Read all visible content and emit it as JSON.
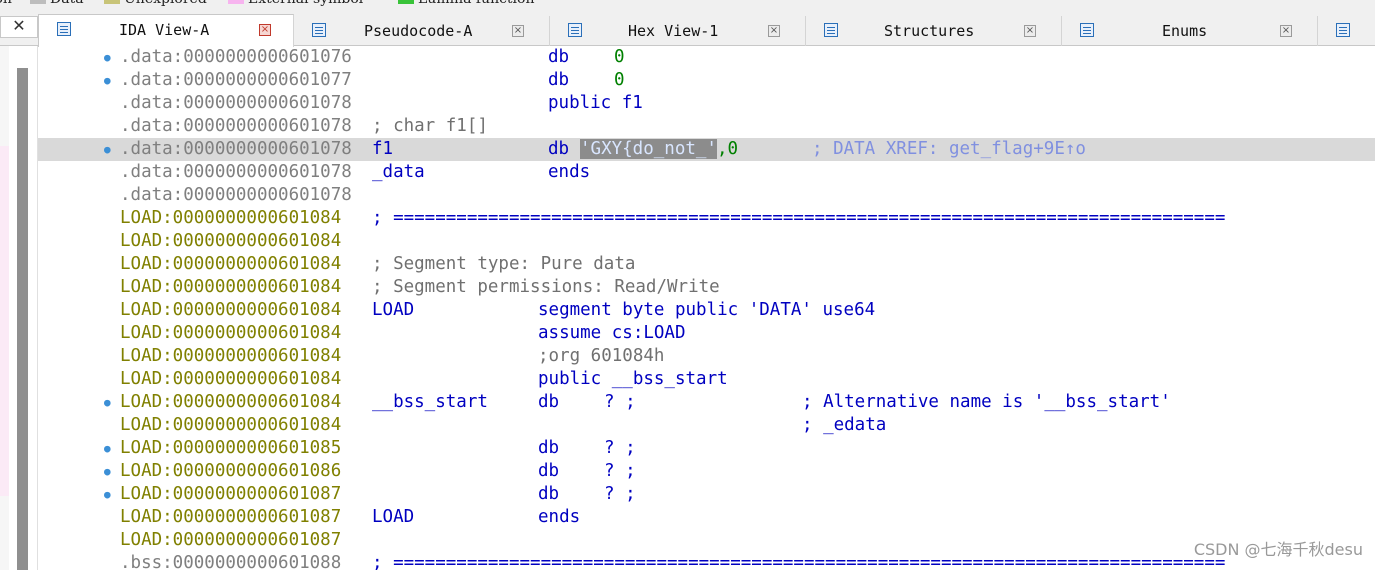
{
  "legend": [
    {
      "label": "ion",
      "color": "#f0f0f0"
    },
    {
      "label": "Data",
      "color": "#bdbdbd"
    },
    {
      "label": "Unexplored",
      "color": "#c8c478"
    },
    {
      "label": "External symbol",
      "color": "#f7b4ef"
    },
    {
      "label": "Lumina function",
      "color": "#39c339"
    }
  ],
  "left_close": "✕",
  "tabs": [
    {
      "label": "IDA View-A",
      "active": true
    },
    {
      "label": "Pseudocode-A",
      "active": false
    },
    {
      "label": "Hex View-1",
      "active": false
    },
    {
      "label": "Structures",
      "active": false
    },
    {
      "label": "Enums",
      "active": false
    }
  ],
  "close_glyph": "×",
  "listing": [
    {
      "seg": "data",
      "dot": true,
      "addr": ".data:0000000000601076",
      "ins": "db",
      "opnd_num": "0"
    },
    {
      "seg": "data",
      "dot": true,
      "addr": ".data:0000000000601077",
      "ins": "db",
      "opnd_num": "0"
    },
    {
      "seg": "data",
      "dot": false,
      "addr": ".data:0000000000601078",
      "ins": "public f1"
    },
    {
      "seg": "data",
      "dot": false,
      "addr": ".data:0000000000601078",
      "cmt": "; char f1[]"
    },
    {
      "seg": "data",
      "dot": true,
      "addr": ".data:0000000000601078",
      "label": "f1",
      "ins": "db",
      "opnd_str": "'GXY{do_not_'",
      "opnd_tail": ",0",
      "xref": "; DATA XREF: get_flag+9E↑o",
      "highlight": true
    },
    {
      "seg": "data",
      "dot": false,
      "addr": ".data:0000000000601078",
      "label": "_data",
      "ins": "ends"
    },
    {
      "seg": "data",
      "dot": false,
      "addr": ".data:0000000000601078"
    },
    {
      "seg": "load",
      "dot": false,
      "addr": "LOAD:0000000000601084",
      "sep": "; ==============================================================================="
    },
    {
      "seg": "load",
      "dot": false,
      "addr": "LOAD:0000000000601084"
    },
    {
      "seg": "load",
      "dot": false,
      "addr": "LOAD:0000000000601084",
      "cmt": "; Segment type: Pure data"
    },
    {
      "seg": "load",
      "dot": false,
      "addr": "LOAD:0000000000601084",
      "cmt": "; Segment permissions: Read/Write"
    },
    {
      "seg": "load",
      "dot": false,
      "addr": "LOAD:0000000000601084",
      "label": "LOAD",
      "ins": "segment byte public 'DATA' use64"
    },
    {
      "seg": "load",
      "dot": false,
      "addr": "LOAD:0000000000601084",
      "ins": "assume cs:LOAD"
    },
    {
      "seg": "load",
      "dot": false,
      "addr": "LOAD:0000000000601084",
      "ins": ";org 601084h",
      "ins_gray": true
    },
    {
      "seg": "load",
      "dot": false,
      "addr": "LOAD:0000000000601084",
      "ins": "public __bss_start"
    },
    {
      "seg": "load",
      "dot": true,
      "addr": "LOAD:0000000000601084",
      "label": "__bss_start",
      "ins": "db",
      "opnd_q": "? ;",
      "rcmt": "; Alternative name is '__bss_start'"
    },
    {
      "seg": "load",
      "dot": false,
      "addr": "LOAD:0000000000601084",
      "rcmt": "; _edata"
    },
    {
      "seg": "load",
      "dot": true,
      "addr": "LOAD:0000000000601085",
      "ins": "db",
      "opnd_q": "? ;"
    },
    {
      "seg": "load",
      "dot": true,
      "addr": "LOAD:0000000000601086",
      "ins": "db",
      "opnd_q": "? ;"
    },
    {
      "seg": "load",
      "dot": true,
      "addr": "LOAD:0000000000601087",
      "ins": "db",
      "opnd_q": "? ;"
    },
    {
      "seg": "load",
      "dot": false,
      "addr": "LOAD:0000000000601087",
      "label": "LOAD",
      "ins": "ends"
    },
    {
      "seg": "load",
      "dot": false,
      "addr": "LOAD:0000000000601087"
    },
    {
      "seg": "bss",
      "dot": false,
      "addr": ".bss:0000000000601088",
      "sep": "; ==============================================================================="
    }
  ],
  "watermark": "CSDN @七海千秋desu"
}
